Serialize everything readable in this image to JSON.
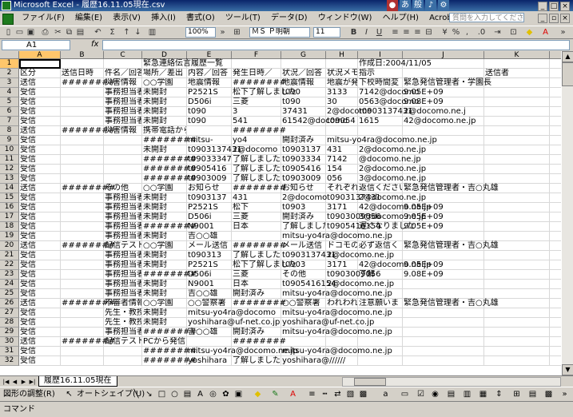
{
  "window": {
    "title": "Microsoft Excel - 履歴16.11.05現在.csv",
    "help_placeholder": "質問を入力してください"
  },
  "menus": [
    "ファイル(F)",
    "編集(E)",
    "表示(V)",
    "挿入(I)",
    "書式(O)",
    "ツール(T)",
    "データ(D)",
    "ウィンドウ(W)",
    "ヘルプ(H)",
    "Acrobat(B)"
  ],
  "toolbar": {
    "zoom": "100%",
    "font": "ＭＳ Ｐ明朝",
    "size": "11"
  },
  "formula": {
    "name_box": "A1",
    "fx": "fx",
    "content": ""
  },
  "columns": [
    "A",
    "B",
    "C",
    "D",
    "E",
    "F",
    "G",
    "H",
    "I",
    "J",
    "K",
    "L",
    "M"
  ],
  "rows": [
    [
      "",
      "",
      "",
      "緊急連絡伝言履歴一覧",
      "",
      "",
      "",
      "",
      "作成日:2004/11/05",
      "",
      "",
      "",
      ""
    ],
    [
      "区分",
      "送信日時",
      "件名／回答",
      "場所／差出",
      "内容／回答",
      "発生日時／",
      "状況／回答",
      "状況メモ／",
      "指示",
      "",
      "送信者",
      "",
      ""
    ],
    [
      "送信",
      "########",
      "災害情報",
      "○○学園",
      "地震情報",
      "########",
      "地震情報",
      "地震が発生",
      "下校時間変",
      "緊急発信管理者・学園長",
      "",
      "",
      ""
    ],
    [
      "受信",
      "",
      "事務担当者",
      "未開封",
      "P2521S",
      "松下了解しました",
      "t090",
      "3133",
      "7142@docomo",
      "9.05E+09",
      "",
      "",
      ""
    ],
    [
      "受信",
      "",
      "事務担当者",
      "未開封",
      "D506i",
      "三菱",
      "t090",
      "30",
      "0563@docomo",
      "9.08E+09",
      "",
      "",
      ""
    ],
    [
      "受信",
      "",
      "事務担当者",
      "未開封",
      "t090",
      "3",
      "37431",
      "2@docomo",
      "t0903137431",
      "2@docomo.ne.j",
      "",
      "",
      ""
    ],
    [
      "受信",
      "",
      "事務担当者",
      "未開封",
      "t090",
      "541",
      "61542@docomo",
      "t09054",
      "1615",
      "42@docomo.ne.jp",
      "",
      "",
      ""
    ],
    [
      "送信",
      "########",
      "災害情報",
      "携帯電話から",
      "",
      "########",
      "",
      "",
      "",
      "",
      "",
      "",
      ""
    ],
    [
      "受信",
      "",
      "",
      "########",
      "mitsu-",
      "yo4",
      "開封済み",
      "mitsu-yo4ra@docomo.ne.jp",
      "",
      "",
      "",
      "",
      ""
    ],
    [
      "受信",
      "",
      "",
      "未開封",
      "t0903137431",
      "2@docomo",
      "t0903137",
      "431",
      "2@docomo.ne.jp",
      "",
      "",
      "",
      ""
    ],
    [
      "受信",
      "",
      "",
      "########",
      "t09033347",
      "了解しました",
      "t0903334",
      "7142",
      "@docomo.ne.jp",
      "",
      "",
      "",
      ""
    ],
    [
      "受信",
      "",
      "",
      "########",
      "t0905416",
      "了解しました",
      "t0905416",
      "154",
      "2@docomo.ne.jp",
      "",
      "",
      "",
      ""
    ],
    [
      "受信",
      "",
      "",
      "########",
      "t0903009",
      "了解しました",
      "t0903009",
      "056",
      "3@docomo.ne.jp",
      "",
      "",
      "",
      ""
    ],
    [
      "送信",
      "########",
      "その他",
      "○○学園",
      "お知らせ",
      "########",
      "お知らせ",
      "それぞれの",
      "返信ください",
      "緊急発信管理者・吉○丸雄",
      "",
      "",
      ""
    ],
    [
      "受信",
      "",
      "事務担当者",
      "未開封",
      "t0903137",
      "431",
      "2@docomo",
      "t0903137431",
      "2@docomo.ne.jp",
      "",
      "",
      "",
      ""
    ],
    [
      "受信",
      "",
      "事務担当者",
      "未開封",
      "P2521S",
      "松下",
      "t0903",
      "3171",
      "42@docomo.ne.jp",
      "9.05E+09",
      "",
      "",
      ""
    ],
    [
      "受信",
      "",
      "事務担当者",
      "未開封",
      "D506i",
      "三菱",
      "開封済み",
      "t0903009056",
      "3@docomo.ne.jp",
      "9.05E+09",
      "",
      "",
      ""
    ],
    [
      "受信",
      "",
      "事務担当者",
      "########",
      "N9001",
      "日本",
      "了解しました",
      "t0905416154",
      "遅くなりました",
      "9.05E+09",
      "",
      "",
      ""
    ],
    [
      "受信",
      "",
      "事務担当者",
      "未開封",
      "吉○○雄",
      "",
      "mitsu-yo4ra@docomo.ne.jp",
      "",
      "",
      "",
      "",
      "",
      ""
    ],
    [
      "送信",
      "########",
      "配信テスト",
      "○○学園",
      "メール送信",
      "########",
      "メール送信",
      "ドコモの新",
      "必ず返信く",
      "緊急発信管理者・吉○丸雄",
      "",
      "",
      ""
    ],
    [
      "受信",
      "",
      "事務担当者",
      "未開封",
      "t090313",
      "了解しました",
      "t0903137431",
      "2@docomo.ne.jp",
      "",
      "",
      "",
      "",
      ""
    ],
    [
      "受信",
      "",
      "事務担当者",
      "未開封",
      "P2521S",
      "松下了解しました",
      "t0903",
      "3171",
      "42@docomo.ne.jp",
      "9.05E+09",
      "",
      "",
      ""
    ],
    [
      "受信",
      "",
      "事務担当者",
      "########",
      "D506i",
      "三菱",
      "その他",
      "t0903009056",
      "了解",
      "9.08E+09",
      "",
      "",
      ""
    ],
    [
      "受信",
      "",
      "事務担当者",
      "未開封",
      "N9001",
      "日本",
      "t0905416154",
      "2@docomo.ne.jp",
      "",
      "",
      "",
      "",
      ""
    ],
    [
      "受信",
      "",
      "事務担当者",
      "未開封",
      "吉○○雄",
      "開封済み",
      "mitsu-yo4ra@docomo.ne.jp",
      "",
      "",
      "",
      "",
      "",
      ""
    ],
    [
      "送信",
      "########",
      "不審者情報",
      "○○学園",
      "○○警察署",
      "########",
      "○○警察署",
      "われわれ",
      "注意願いま",
      "緊急発信管理者・吉○丸雄",
      "",
      "",
      ""
    ],
    [
      "受信",
      "",
      "先生・教授",
      "未開封",
      "mitsu-yo4ra@docomo",
      "",
      "mitsu-yo4ra@docomo.ne.jp",
      "",
      "",
      "",
      "",
      "",
      ""
    ],
    [
      "受信",
      "",
      "先生・教授",
      "未開封",
      "yoshihara@uf-net.co.jp",
      "",
      "yoshihara@uf-net.co.jp",
      "",
      "",
      "",
      "",
      "",
      ""
    ],
    [
      "受信",
      "",
      "事務担当者",
      "########",
      "吉○○雄",
      "開封済み",
      "mitsu-yo4ra@docomo.ne.jp",
      "",
      "",
      "",
      "",
      "",
      ""
    ],
    [
      "送信",
      "########",
      "配信テスト",
      "PCから発信",
      "",
      "########",
      "",
      "",
      "",
      "",
      "",
      "",
      ""
    ],
    [
      "受信",
      "",
      "",
      "########",
      "mitsu-yo4ra@docomo.ne.jp",
      "",
      "mitsu-yo4ra@docomo.ne.jp",
      "",
      "",
      "",
      "",
      "",
      ""
    ],
    [
      "受信",
      "",
      "",
      "########",
      "yoshihara",
      "了解しました",
      "yoshihara@//////",
      "",
      "",
      "",
      "",
      "",
      ""
    ]
  ],
  "sheet_tab": "履歴16.11.05現在",
  "drawing": {
    "draw_label": "図形の調整(R)",
    "autoshape_label": "オートシェイプ(U)"
  },
  "status_text": "コマンド"
}
